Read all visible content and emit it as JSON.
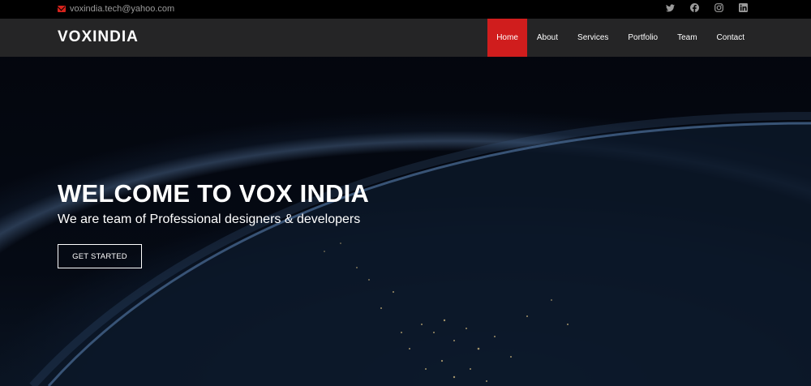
{
  "topbar": {
    "email": "voxindia.tech@yahoo.com",
    "social": [
      "twitter-icon",
      "facebook-icon",
      "instagram-icon",
      "linkedin-icon"
    ]
  },
  "navbar": {
    "logo": "VOXINDIA",
    "items": [
      {
        "label": "Home",
        "active": true
      },
      {
        "label": "About",
        "active": false
      },
      {
        "label": "Services",
        "active": false
      },
      {
        "label": "Portfolio",
        "active": false
      },
      {
        "label": "Team",
        "active": false
      },
      {
        "label": "Contact",
        "active": false
      }
    ]
  },
  "hero": {
    "title": "WELCOME TO VOX INDIA",
    "subtitle": "We are team of Professional designers & developers",
    "cta": "GET STARTED"
  },
  "colors": {
    "accent": "#d01d1d",
    "navbar_bg": "#282828",
    "topbar_bg": "#000000",
    "text": "#ffffff"
  }
}
